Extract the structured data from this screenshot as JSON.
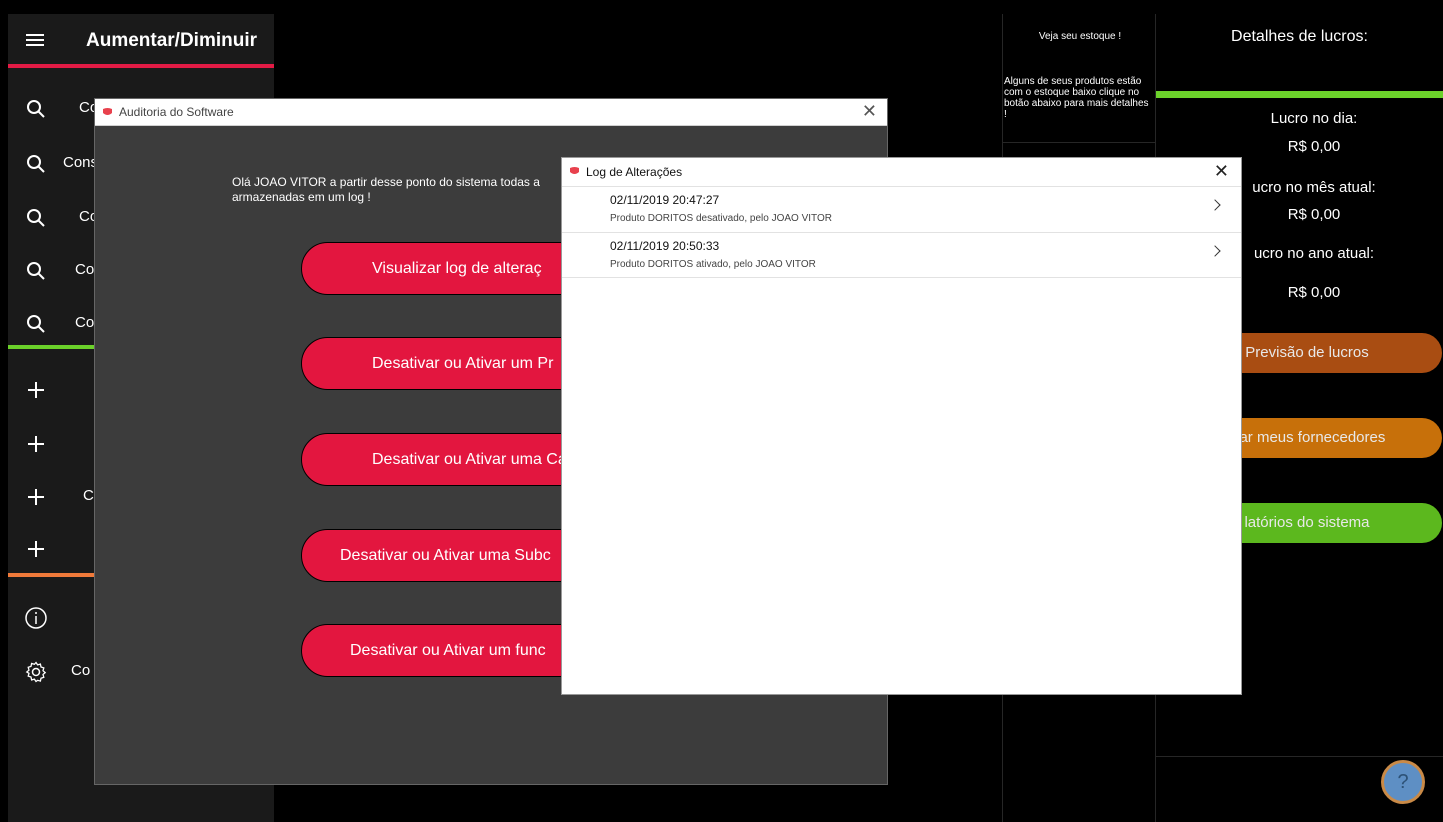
{
  "sidebar": {
    "title": "Aumentar/Diminuir",
    "items": [
      {
        "icon": "search-icon",
        "label": "Co"
      },
      {
        "icon": "search-icon",
        "label": "Cons"
      },
      {
        "icon": "search-icon",
        "label": "Co"
      },
      {
        "icon": "search-icon",
        "label": "Co"
      },
      {
        "icon": "search-icon",
        "label": "Co"
      },
      {
        "icon": "plus-icon",
        "label": ""
      },
      {
        "icon": "plus-icon",
        "label": ""
      },
      {
        "icon": "plus-icon",
        "label": "C"
      },
      {
        "icon": "plus-icon",
        "label": ""
      },
      {
        "icon": "info-icon",
        "label": ""
      },
      {
        "icon": "gear-icon",
        "label": "Co"
      }
    ],
    "colors": {
      "header_bar": "#e31b45",
      "search_bar": "#6bd12a",
      "plus_bar": "#f07a3a"
    }
  },
  "stock": {
    "title": "Veja seu estoque !",
    "text": "Alguns de seus produtos estão com o estoque baixo clique no botão abaixo para mais detalhes !"
  },
  "profit": {
    "title": "Detalhes de lucros:",
    "day_label": "Lucro no dia:",
    "day_value": "R$ 0,00",
    "month_label": "ucro no mês atual:",
    "month_value": "R$ 0,00",
    "year_label": "ucro no ano atual:",
    "year_value": "R$ 0,00",
    "btn_forecast": "Previsão de lucros",
    "btn_suppliers": "ciar meus fornecedores",
    "btn_reports": "latórios do sistema",
    "colors": {
      "forecast": "#a94d12",
      "suppliers": "#c7700a",
      "reports": "#5cb81e"
    }
  },
  "audit": {
    "title": "Auditoria do Software",
    "text": "Olá JOAO VITOR a partir desse ponto do sistema todas a armazenadas em um log !",
    "buttons": [
      "Visualizar log de alteraç",
      "Desativar ou Ativar um Pr",
      "Desativar ou Ativar uma Ca",
      "Desativar ou Ativar uma Subc",
      "Desativar ou Ativar um func"
    ]
  },
  "log": {
    "title": "Log de Alterações",
    "rows": [
      {
        "date": "02/11/2019 20:47:27",
        "desc": "Produto DORITOS desativado, pelo JOAO VITOR"
      },
      {
        "date": "02/11/2019 20:50:33",
        "desc": "Produto DORITOS ativado, pelo JOAO VITOR"
      }
    ]
  },
  "help": {
    "label": "?"
  }
}
